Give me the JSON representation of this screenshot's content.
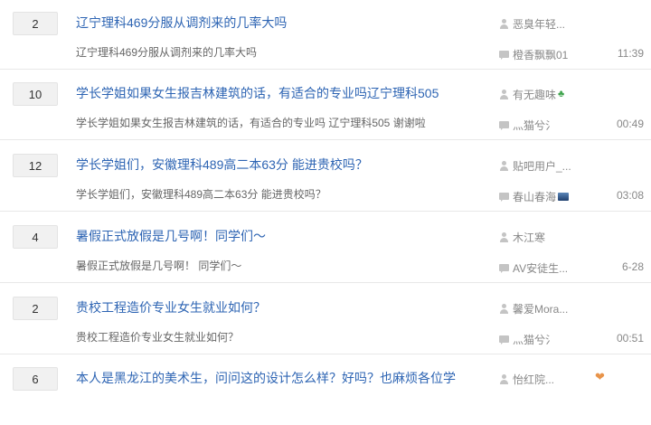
{
  "threads": [
    {
      "reply_count": "2",
      "title": "辽宁理科469分服从调剂来的几率大吗",
      "excerpt": "辽宁理科469分服从调剂来的几率大吗",
      "author": "恶臭年轻...",
      "last_replier": "橙香飘飘01",
      "time": "11:39"
    },
    {
      "reply_count": "10",
      "title": "学长学姐如果女生报吉林建筑的话，有适合的专业吗辽宁理科505",
      "excerpt": "学长学姐如果女生报吉林建筑的话，有适合的专业吗 辽宁理科505 谢谢啦",
      "author": "有无趣味",
      "author_badge": "clover-icon",
      "last_replier": "灬猫兮氵",
      "time": "00:49"
    },
    {
      "reply_count": "12",
      "title": "学长学姐们，安徽理科489高二本63分 能进贵校吗？",
      "excerpt": "学长学姐们，安徽理科489高二本63分 能进贵校吗？",
      "author": "贴吧用户_...",
      "last_replier": "春山春海",
      "replier_badge": "wave-badge-icon",
      "time": "03:08"
    },
    {
      "reply_count": "4",
      "title": "暑假正式放假是几号啊！同学们～",
      "excerpt": "暑假正式放假是几号啊！ 同学们～",
      "author": "木江寒",
      "last_replier": "AV安徒生...",
      "time": "6-28"
    },
    {
      "reply_count": "2",
      "title": "贵校工程造价专业女生就业如何？",
      "excerpt": "贵校工程造价专业女生就业如何？",
      "author": "馨爱Mora...",
      "last_replier": "灬猫兮氵",
      "time": "00:51"
    },
    {
      "reply_count": "6",
      "title": "本人是黑龙江的美术生，问问这的设计怎么样？好吗？也麻烦各位学",
      "author": "怡红院...",
      "author_badge": "lungs-icon"
    }
  ]
}
